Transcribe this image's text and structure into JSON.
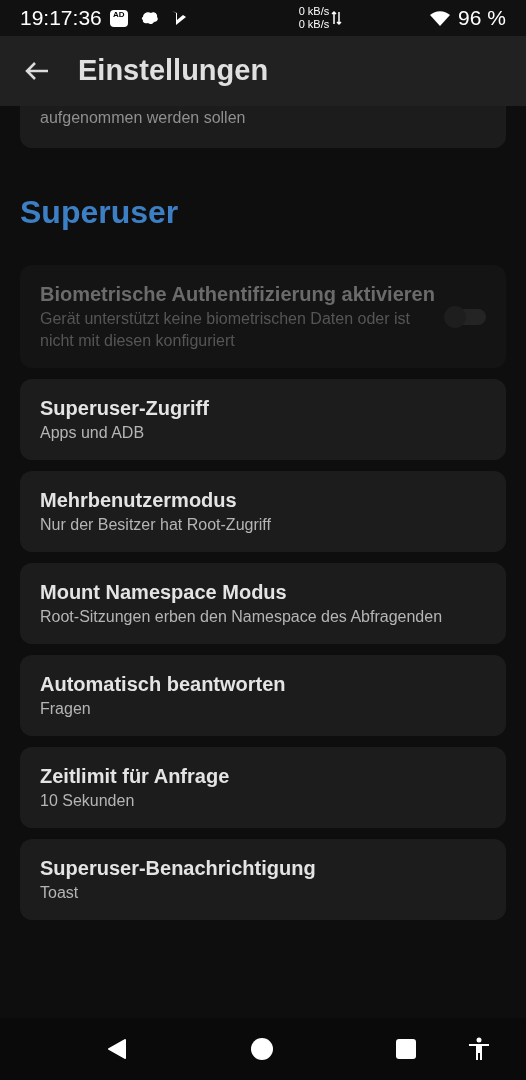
{
  "status_bar": {
    "time": "19:17:36",
    "ad_badge": "AD",
    "net_up": "0 kB/s",
    "net_down": "0 kB/s",
    "battery": "96 %"
  },
  "app_bar": {
    "title": "Einstellungen"
  },
  "partial_card": {
    "subtitle": "aufgenommen werden sollen"
  },
  "section": {
    "title": "Superuser"
  },
  "items": [
    {
      "kind": "switch",
      "title": "Biometrische Authentifizierung aktivieren",
      "subtitle": "Gerät unterstützt keine biometrischen Daten oder ist nicht mit diesen konfiguriert",
      "disabled": true,
      "on": false
    },
    {
      "kind": "plain",
      "title": "Superuser-Zugriff",
      "subtitle": "Apps und ADB",
      "disabled": false
    },
    {
      "kind": "plain",
      "title": "Mehrbenutzermodus",
      "subtitle": "Nur der Besitzer hat Root-Zugriff",
      "disabled": false
    },
    {
      "kind": "plain",
      "title": "Mount Namespace Modus",
      "subtitle": "Root-Sitzungen erben den Namespace des Abfragenden",
      "disabled": false
    },
    {
      "kind": "plain",
      "title": "Automatisch beantworten",
      "subtitle": "Fragen",
      "disabled": false
    },
    {
      "kind": "plain",
      "title": "Zeitlimit für Anfrage",
      "subtitle": "10 Sekunden",
      "disabled": false
    },
    {
      "kind": "plain",
      "title": "Superuser-Benachrichtigung",
      "subtitle": "Toast",
      "disabled": false
    }
  ]
}
